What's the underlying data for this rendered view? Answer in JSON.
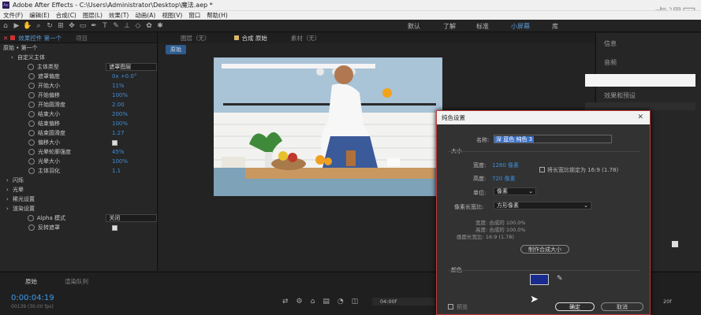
{
  "titlebar": {
    "app_badge": "Ae",
    "title": "Adobe After Effects - C:\\Users\\Administrator\\Desktop\\魔法.aep *"
  },
  "menu": [
    "文件(F)",
    "编辑(E)",
    "合成(C)",
    "图层(L)",
    "效果(T)",
    "动画(A)",
    "视图(V)",
    "窗口",
    "帮助(H)"
  ],
  "watermark": "虎课网",
  "workspaces": [
    "默认",
    "了解",
    "标准",
    "小屏幕",
    "库"
  ],
  "left_panel": {
    "tabs": [
      "效果控件 第一个",
      "项目"
    ],
    "layer_path": "原始 • 第一个",
    "properties": [
      {
        "label": "自定义主体",
        "value": "",
        "kind": "group"
      },
      {
        "label": "主体类型",
        "value": "遮罩图层",
        "kind": "select"
      },
      {
        "label": "遮罩偏度",
        "value": "0x +0.0°",
        "kind": "value"
      },
      {
        "label": "开始大小",
        "value": "11%",
        "kind": "value"
      },
      {
        "label": "开始偏移",
        "value": "100%",
        "kind": "value"
      },
      {
        "label": "开始圆滑度",
        "value": "2.00",
        "kind": "value"
      },
      {
        "label": "结束大小",
        "value": "200%",
        "kind": "value"
      },
      {
        "label": "结束偏移",
        "value": "100%",
        "kind": "value"
      },
      {
        "label": "结束圆滑度",
        "value": "1.27",
        "kind": "value"
      },
      {
        "label": "偏移大小",
        "value": "",
        "kind": "check"
      },
      {
        "label": "光晕轮廓强度",
        "value": "45%",
        "kind": "value"
      },
      {
        "label": "光晕大小",
        "value": "100%",
        "kind": "value"
      },
      {
        "label": "主体羽化",
        "value": "1.1",
        "kind": "value"
      },
      {
        "label": "闪烁",
        "value": "",
        "kind": "group"
      },
      {
        "label": "光晕",
        "value": "",
        "kind": "group"
      },
      {
        "label": "稀光设置",
        "value": "",
        "kind": "group"
      },
      {
        "label": "渲染设置",
        "value": "",
        "kind": "group"
      },
      {
        "label": "Alpha 模式",
        "value": "关闭",
        "kind": "select"
      },
      {
        "label": "反转遮罩",
        "value": "",
        "kind": "check"
      }
    ]
  },
  "comp_panel": {
    "tabs": [
      "图层（无）",
      "合成 原始",
      "素材（无）"
    ],
    "nav_label": "原始"
  },
  "right_panel": {
    "items": [
      "信息",
      "音频",
      "效果和预设"
    ]
  },
  "timeline": {
    "tab": "原始",
    "tab2": "渲染队列",
    "timecode": "0:00:04:19",
    "frames": "00139 (30.00 fps)",
    "ruler": [
      "04:00f",
      "",
      "20f"
    ]
  },
  "dialog": {
    "title": "纯色设置",
    "name_label": "名称:",
    "name_value": "深 蓝色 纯色 3",
    "size_group": "大小",
    "width_label": "宽度:",
    "width_value": "1280 像素",
    "height_label": "高度:",
    "height_value": "720 像素",
    "lock_label": "将长宽比锁定为 16:9 (1.78)",
    "unit_label": "单位:",
    "unit_value": "像素",
    "par_label": "像素长宽比:",
    "par_value": "方形像素",
    "info_w": "宽度: 合成的 100.0%",
    "info_h": "高度: 合成的 100.0%",
    "info_ratio": "画面长宽比: 16:9 (1.78)",
    "make_comp_size": "制作合成大小",
    "color_group": "颜色",
    "swatch_color": "#1a2b8f",
    "preview_label": "预览",
    "ok": "确定",
    "cancel": "取消"
  }
}
